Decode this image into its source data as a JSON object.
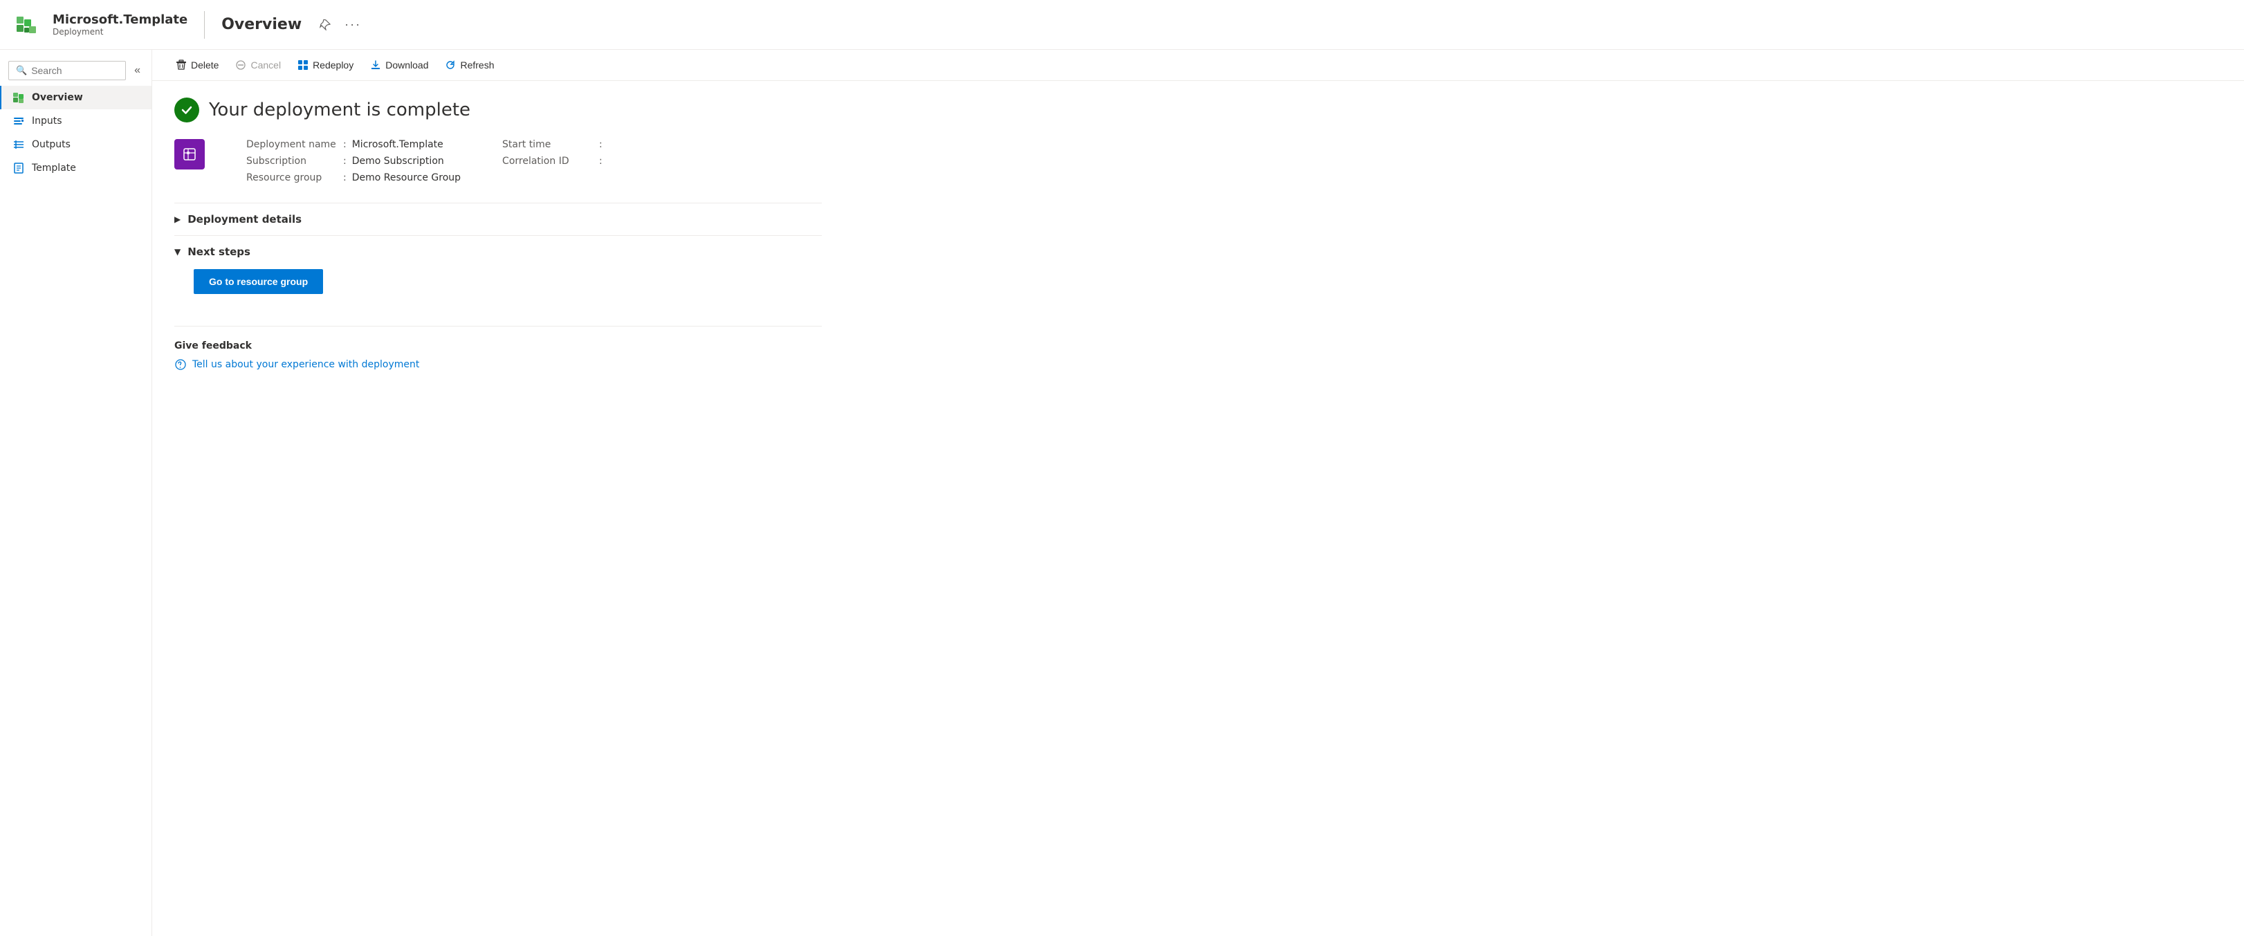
{
  "header": {
    "logo_alt": "Azure logo",
    "main_title": "Microsoft.Template",
    "subtitle": "Deployment",
    "page_title": "Overview",
    "pin_label": "Pin",
    "more_label": "More options"
  },
  "search": {
    "placeholder": "Search"
  },
  "collapse": {
    "label": "Collapse"
  },
  "nav": {
    "items": [
      {
        "id": "overview",
        "label": "Overview",
        "active": true
      },
      {
        "id": "inputs",
        "label": "Inputs"
      },
      {
        "id": "outputs",
        "label": "Outputs"
      },
      {
        "id": "template",
        "label": "Template"
      }
    ]
  },
  "toolbar": {
    "delete_label": "Delete",
    "cancel_label": "Cancel",
    "redeploy_label": "Redeploy",
    "download_label": "Download",
    "refresh_label": "Refresh"
  },
  "deployment": {
    "complete_message": "Your deployment is complete",
    "name_label": "Deployment name",
    "name_value": "Microsoft.Template",
    "subscription_label": "Subscription",
    "subscription_value": "Demo Subscription",
    "resource_group_label": "Resource group",
    "resource_group_value": "Demo Resource Group",
    "start_time_label": "Start time",
    "start_time_value": "",
    "correlation_id_label": "Correlation ID",
    "correlation_id_value": ""
  },
  "sections": {
    "deployment_details_label": "Deployment details",
    "next_steps_label": "Next steps",
    "go_to_resource_group_label": "Go to resource group"
  },
  "feedback": {
    "title": "Give feedback",
    "link_label": "Tell us about your experience with deployment"
  }
}
